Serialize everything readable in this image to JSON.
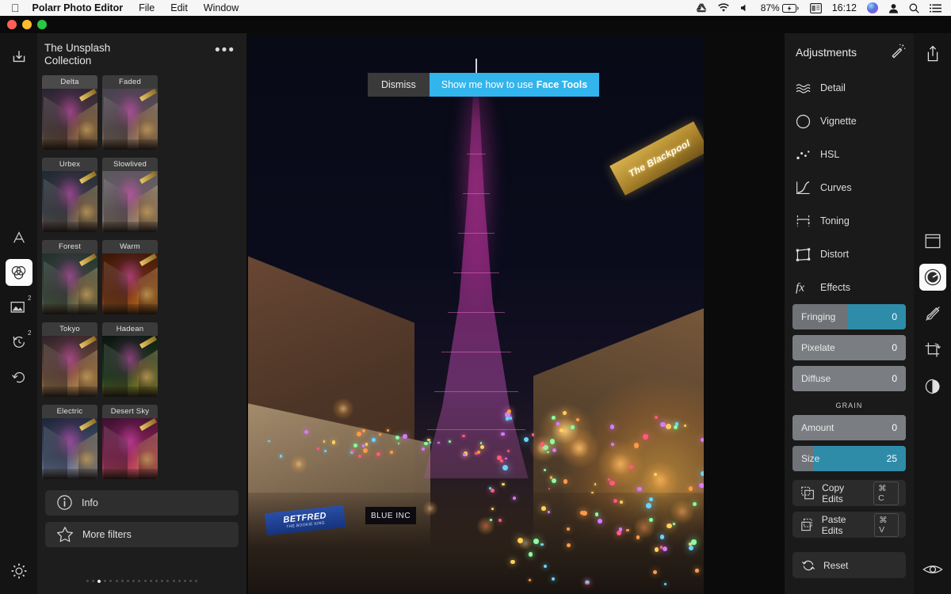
{
  "menubar": {
    "apple_icon": "apple-icon",
    "app_name": "Polarr Photo Editor",
    "menus": [
      "File",
      "Edit",
      "Window"
    ],
    "status_icons": [
      "google-drive-icon",
      "wifi-icon",
      "volume-icon"
    ],
    "battery_percent": "87%",
    "battery_icon": "battery-charging-icon",
    "calendar_icon": "calendar-icon",
    "clock": "16:12",
    "siri_icon": "siri-icon",
    "user_icon": "user-icon",
    "search_icon": "search-icon",
    "notification_icon": "notification-list-icon"
  },
  "window": {
    "close_label": "close",
    "minimize_label": "minimize",
    "zoom_label": "zoom"
  },
  "left_rail": {
    "items": [
      {
        "name": "text-tool",
        "icon": "letter-a-icon",
        "badge": "",
        "active": false
      },
      {
        "name": "filters-tool",
        "icon": "overlapping-circles-icon",
        "badge": "",
        "active": true
      },
      {
        "name": "overlay-tool",
        "icon": "image-icon",
        "badge": "2",
        "active": false
      },
      {
        "name": "history-tool",
        "icon": "clock-history-icon",
        "badge": "2",
        "active": false
      },
      {
        "name": "undo-tool",
        "icon": "undo-arrow-icon",
        "badge": "",
        "active": false
      }
    ],
    "settings_icon": "gear-icon",
    "import_icon": "download-import-icon"
  },
  "sidebar": {
    "title": "The Unsplash Collection",
    "overflow_icon": "ellipsis-icon",
    "filters": [
      {
        "label": "Delta",
        "c1": "#2a2334",
        "c2": "#4a3a38",
        "c3": "#8d6a4a"
      },
      {
        "label": "Faded",
        "c1": "#474050",
        "c2": "#5d5150",
        "c3": "#9c8269"
      },
      {
        "label": "Urbex",
        "c1": "#1f2830",
        "c2": "#3a3f46",
        "c3": "#7d7468"
      },
      {
        "label": "Slowlived",
        "c1": "#5a5760",
        "c2": "#6d6260",
        "c3": "#a08f7c"
      },
      {
        "label": "Forest",
        "c1": "#22322c",
        "c2": "#37463a",
        "c3": "#6e7a56"
      },
      {
        "label": "Warm",
        "c1": "#3a1708",
        "c2": "#6b2c0c",
        "c3": "#b5600f"
      },
      {
        "label": "Tokyo",
        "c1": "#2e2228",
        "c2": "#6a4a36",
        "c3": "#c09a5e"
      },
      {
        "label": "Hadean",
        "c1": "#0a1410",
        "c2": "#1d3a1c",
        "c3": "#7a8a20"
      },
      {
        "label": "Electric",
        "c1": "#1d2436",
        "c2": "#41506e",
        "c3": "#8fa6c8"
      },
      {
        "label": "Desert Sky",
        "c1": "#3a1030",
        "c2": "#8c2050",
        "c3": "#e05a6a"
      }
    ],
    "selected_filter": "Delta",
    "info_button": {
      "label": "Info",
      "icon": "info-circle-icon"
    },
    "more_filters_button": {
      "label": "More filters",
      "icon": "star-icon"
    },
    "pager": {
      "total": 20,
      "active_index": 2
    }
  },
  "banner": {
    "dismiss_label": "Dismiss",
    "cta_prefix": "Show me how to use ",
    "cta_bold": "Face Tools",
    "cta_color": "#32b4ec"
  },
  "canvas": {
    "photo_description": "Blackpool Tower at night lit pink",
    "sign_text": "The Blackpool",
    "shop_sign_1": "BETFRED",
    "shop_sign_1_sub": "THE BOOKIE KING",
    "shop_sign_2": "BLUE INC"
  },
  "right_panel": {
    "title": "Adjustments",
    "auto_enhance_icon": "magic-wand-icon",
    "share_icon": "share-export-icon",
    "adjustments": [
      {
        "label": "Detail",
        "icon": "waves-icon"
      },
      {
        "label": "Vignette",
        "icon": "vignette-circle-icon"
      },
      {
        "label": "HSL",
        "icon": "color-dots-icon"
      },
      {
        "label": "Curves",
        "icon": "curve-graph-icon"
      },
      {
        "label": "Toning",
        "icon": "toning-icon"
      },
      {
        "label": "Distort",
        "icon": "distort-frame-icon"
      },
      {
        "label": "Effects",
        "icon": "fx-icon"
      }
    ],
    "sliders": [
      {
        "label": "Fringing",
        "value": "0",
        "fill_pct": 48,
        "accent": true
      },
      {
        "label": "Pixelate",
        "value": "0",
        "fill_pct": 100,
        "accent": false
      },
      {
        "label": "Diffuse",
        "value": "0",
        "fill_pct": 100,
        "accent": false
      }
    ],
    "grain_header": "GRAIN",
    "grain_sliders": [
      {
        "label": "Amount",
        "value": "0",
        "fill_pct": 100,
        "accent": false
      },
      {
        "label": "Size",
        "value": "25",
        "fill_pct": 18,
        "accent": true
      }
    ],
    "accent_color": "#2f8ca8",
    "actions": [
      {
        "label": "Copy Edits",
        "shortcut": "⌘ C",
        "icon": "copy-icon"
      },
      {
        "label": "Paste Edits",
        "shortcut": "⌘ V",
        "icon": "paste-icon"
      }
    ],
    "reset": {
      "label": "Reset",
      "shortcut": "",
      "icon": "reset-circular-arrow-icon"
    }
  },
  "right_rail": {
    "items": [
      {
        "name": "frame-tool",
        "icon": "frame-window-icon",
        "active": false
      },
      {
        "name": "adjust-tool",
        "icon": "knob-dial-icon",
        "active": true
      },
      {
        "name": "retouch-tool",
        "icon": "brush-slash-icon",
        "active": false
      },
      {
        "name": "crop-tool",
        "icon": "crop-rotate-icon",
        "active": false
      },
      {
        "name": "face-tool",
        "icon": "face-portrait-icon",
        "active": false
      }
    ],
    "compare_icon": "eye-icon"
  }
}
